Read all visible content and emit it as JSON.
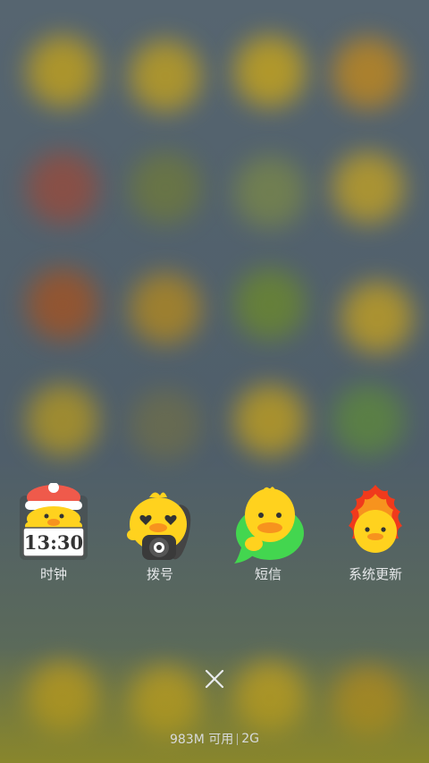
{
  "recent_apps": [
    {
      "label": "时钟",
      "icon": "clock-icon",
      "time_text": "13:30"
    },
    {
      "label": "拨号",
      "icon": "phone-dialer-icon"
    },
    {
      "label": "短信",
      "icon": "messages-icon"
    },
    {
      "label": "系统更新",
      "icon": "system-update-icon"
    }
  ],
  "close_icon": "close-icon",
  "memory": {
    "available": "983M 可用",
    "total": "2G"
  },
  "colors": {
    "duck_yellow": "#ffd21e",
    "beak_orange": "#f7931e",
    "label_text": "#e6e8ea",
    "message_green": "#43d64f",
    "flame_red": "#f03a1c"
  }
}
